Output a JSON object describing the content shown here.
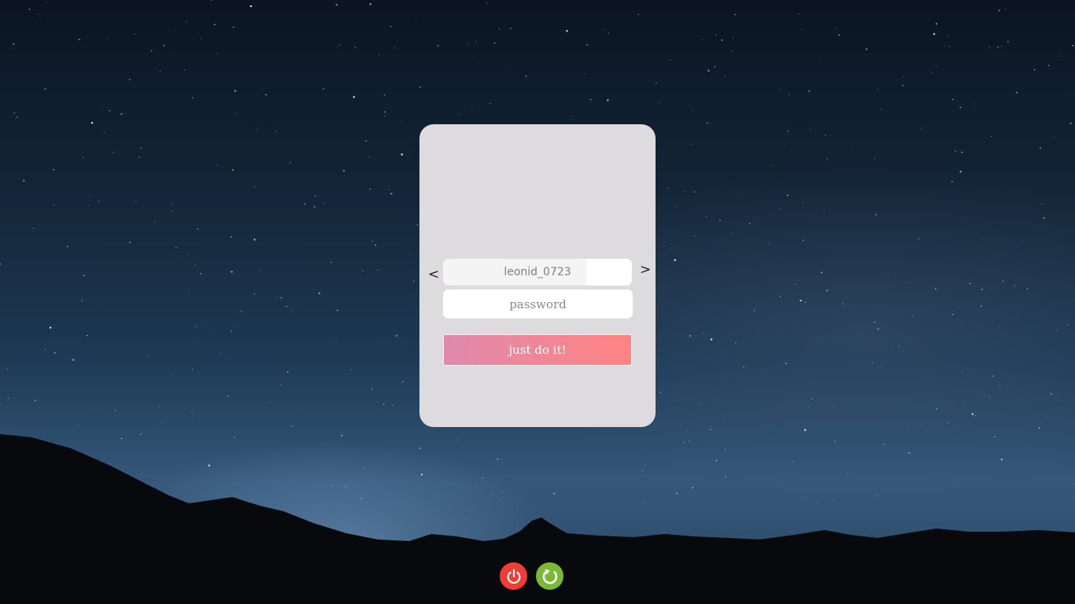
{
  "login": {
    "prev_label": "<",
    "next_label": ">",
    "username": "leonid_0723",
    "password_placeholder": "password",
    "submit_label": "just do it!"
  },
  "system_actions": {
    "power_icon": "power-icon",
    "restart_icon": "restart-icon",
    "power_color": "#ef3d35",
    "restart_color": "#7ab835"
  }
}
